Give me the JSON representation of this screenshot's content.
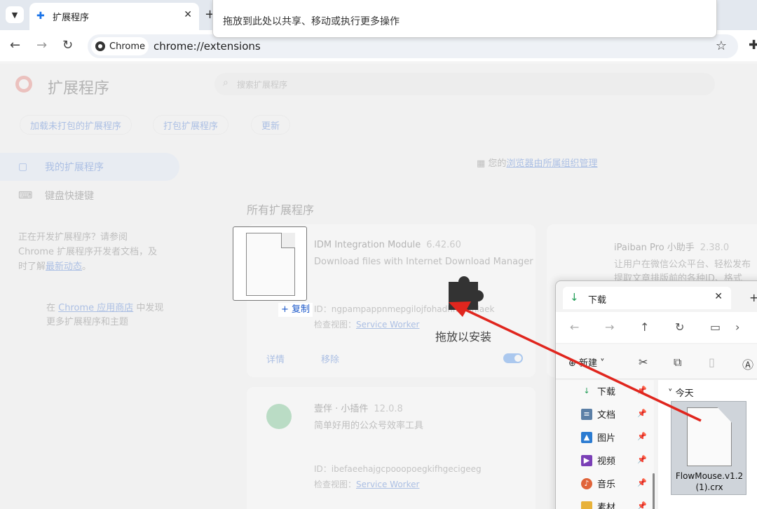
{
  "browser": {
    "tab_title": "扩展程序",
    "chip_label": "Chrome",
    "url": "chrome://extensions"
  },
  "page": {
    "title": "扩展程序",
    "search_placeholder": "搜索扩展程序",
    "buttons": [
      "加载未打包的扩展程序",
      "打包扩展程序",
      "更新"
    ],
    "sidebar": {
      "my_extensions": "我的扩展程序",
      "shortcuts": "键盘快捷键",
      "dev_note_prefix": "正在开发扩展程序？请参阅 Chrome 扩展程序开发者文档，及时了解",
      "dev_note_link": "最新动态",
      "dev_note_suffix": "。",
      "store_prefix": "在",
      "store_link": "Chrome 应用商店",
      "store_suffix": "中发现更多扩展程序和主题"
    },
    "managed_prefix": "您的",
    "managed_link": "浏览器由所属组织管理",
    "section_title": "所有扩展程序",
    "cards": [
      {
        "name": "IDM Integration Module",
        "version": "6.42.60",
        "desc": "Download files with Internet Download Manager",
        "id_label": "ID：",
        "id": "ngpampappnmepgilojfohadhhmbhlaek",
        "view_label": "检查视图：",
        "view_link": "Service Worker",
        "details": "详情",
        "remove": "移除"
      },
      {
        "name": "iPaiban Pro 小助手",
        "version": "2.38.0",
        "desc_line1": "让用户在微信公众平台、轻松发布",
        "desc_line2": "提取文章排版前的各种ID、格式"
      },
      {
        "name": "壹伴 · 小插件",
        "version": "12.0.8",
        "desc": "简单好用的公众号效率工具",
        "id_label": "ID：",
        "id": "ibefaeehajgcpooopoegkifhgecigeeg",
        "view_label": "检查视图：",
        "view_link": "Service Worker"
      }
    ]
  },
  "drop_banner": "拖放到此处以共享、移动或执行更多操作",
  "drag": {
    "copy_tag": "+ 复制",
    "install_label": "拖放以安装"
  },
  "explorer": {
    "tab_title": "下载",
    "new_button": "新建",
    "sidebar_items": [
      "下载",
      "文档",
      "图片",
      "视频",
      "音乐",
      "素材"
    ],
    "group_label": "今天",
    "file_name": "FlowMouse.v1.2 (1).crx"
  },
  "colors": {
    "accent": "#1a73e8",
    "arrow": "#e0261e",
    "puzzle": "#333333"
  }
}
